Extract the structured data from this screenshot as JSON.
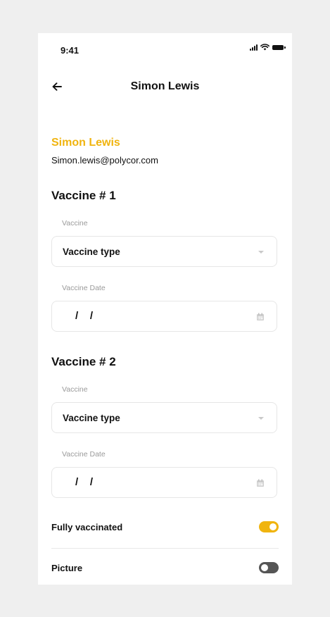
{
  "status_bar": {
    "time": "9:41"
  },
  "header": {
    "title": "Simon Lewis"
  },
  "user": {
    "name": "Simon Lewis",
    "email": "Simon.lewis@polycor.com"
  },
  "vaccines": [
    {
      "title": "Vaccine # 1",
      "vaccine_label": "Vaccine",
      "vaccine_value": "Vaccine type",
      "date_label": "Vaccine Date",
      "date_value": "/    /"
    },
    {
      "title": "Vaccine # 2",
      "vaccine_label": "Vaccine",
      "vaccine_value": "Vaccine type",
      "date_label": "Vaccine Date",
      "date_value": "/    /"
    }
  ],
  "toggles": [
    {
      "label": "Fully vaccinated",
      "on": true
    },
    {
      "label": "Picture",
      "on": false
    }
  ],
  "colors": {
    "accent": "#f0b40f",
    "toggle_off": "#555555"
  }
}
